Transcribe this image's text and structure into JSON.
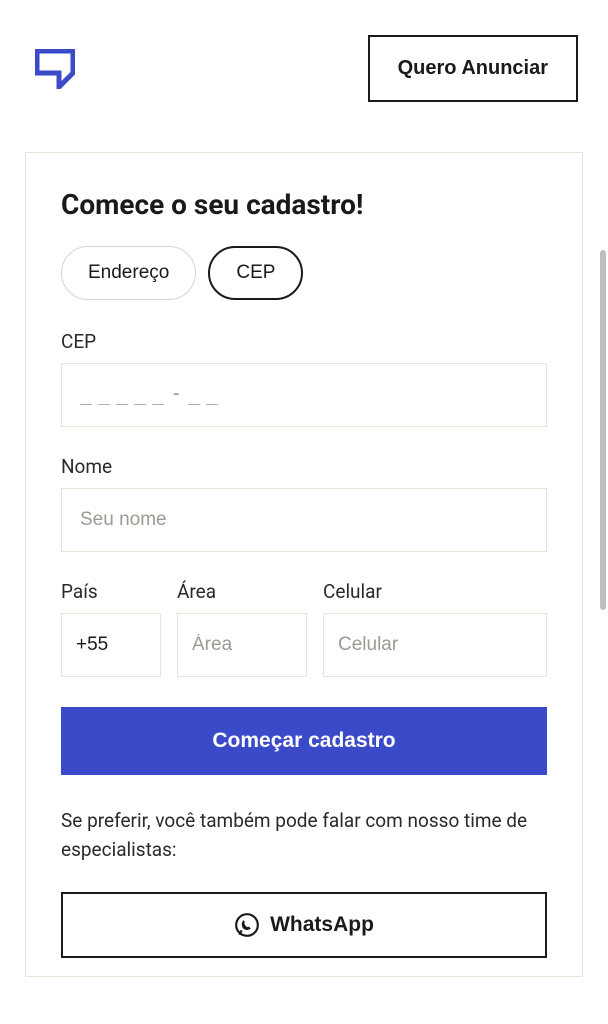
{
  "header": {
    "announce_label": "Quero Anunciar"
  },
  "card": {
    "title": "Comece o seu cadastro!",
    "tabs": {
      "address": "Endereço",
      "cep": "CEP"
    },
    "cep": {
      "label": "CEP",
      "placeholder": "_____-__"
    },
    "name": {
      "label": "Nome",
      "placeholder": "Seu nome"
    },
    "phone": {
      "country_label": "País",
      "country_value": "+55",
      "area_label": "Área",
      "area_placeholder": "Área",
      "cell_label": "Celular",
      "cell_placeholder": "Celular"
    },
    "submit_label": "Começar cadastro",
    "help_text": "Se preferir, você também pode falar com nosso time de especialistas:",
    "whatsapp_label": "WhatsApp"
  }
}
